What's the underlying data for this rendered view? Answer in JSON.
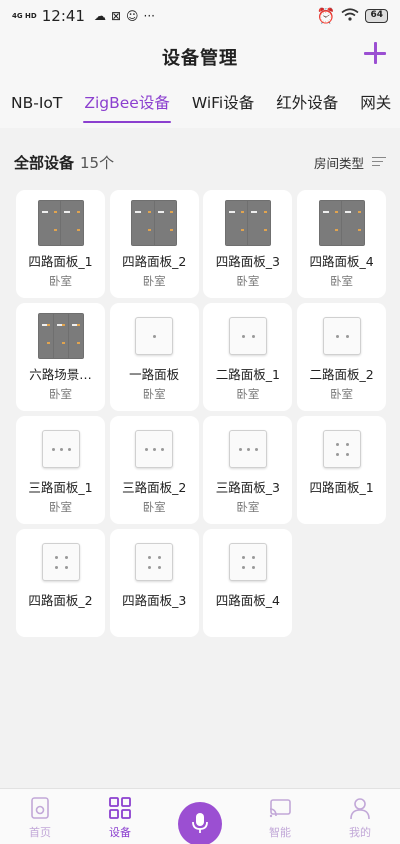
{
  "status_bar": {
    "network": "4G HD",
    "time": "12:41",
    "battery": "64",
    "more": "···"
  },
  "header": {
    "title": "设备管理",
    "add_icon": "plus-icon",
    "accent_color": "#8b3fcf"
  },
  "tabs": [
    {
      "label": "NB-IoT",
      "active": false
    },
    {
      "label": "ZigBee设备",
      "active": true
    },
    {
      "label": "WiFi设备",
      "active": false
    },
    {
      "label": "红外设备",
      "active": false
    },
    {
      "label": "网关",
      "active": false
    }
  ],
  "section": {
    "title": "全部设备",
    "count": "15个",
    "filter_label": "房间类型"
  },
  "devices": [
    {
      "name": "四路面板_1",
      "room": "卧室",
      "style": "dark-4"
    },
    {
      "name": "四路面板_2",
      "room": "卧室",
      "style": "dark-4"
    },
    {
      "name": "四路面板_3",
      "room": "卧室",
      "style": "dark-4"
    },
    {
      "name": "四路面板_4",
      "room": "卧室",
      "style": "dark-4"
    },
    {
      "name": "六路场景…",
      "room": "卧室",
      "style": "dark-6"
    },
    {
      "name": "一路面板",
      "room": "卧室",
      "style": "light-1"
    },
    {
      "name": "二路面板_1",
      "room": "卧室",
      "style": "light-2"
    },
    {
      "name": "二路面板_2",
      "room": "卧室",
      "style": "light-2"
    },
    {
      "name": "三路面板_1",
      "room": "卧室",
      "style": "light-3"
    },
    {
      "name": "三路面板_2",
      "room": "卧室",
      "style": "light-3"
    },
    {
      "name": "三路面板_3",
      "room": "卧室",
      "style": "light-3"
    },
    {
      "name": "四路面板_1",
      "room": "",
      "style": "light-4"
    },
    {
      "name": "四路面板_2",
      "room": "",
      "style": "light-4"
    },
    {
      "name": "四路面板_3",
      "room": "",
      "style": "light-4"
    },
    {
      "name": "四路面板_4",
      "room": "",
      "style": "light-4"
    }
  ],
  "bottom_nav": [
    {
      "label": "首页",
      "icon": "home-icon",
      "active": false
    },
    {
      "label": "设备",
      "icon": "grid-icon",
      "active": true
    },
    {
      "label": "",
      "icon": "microphone-icon",
      "active": false
    },
    {
      "label": "智能",
      "icon": "cast-icon",
      "active": false
    },
    {
      "label": "我的",
      "icon": "user-icon",
      "active": false
    }
  ]
}
